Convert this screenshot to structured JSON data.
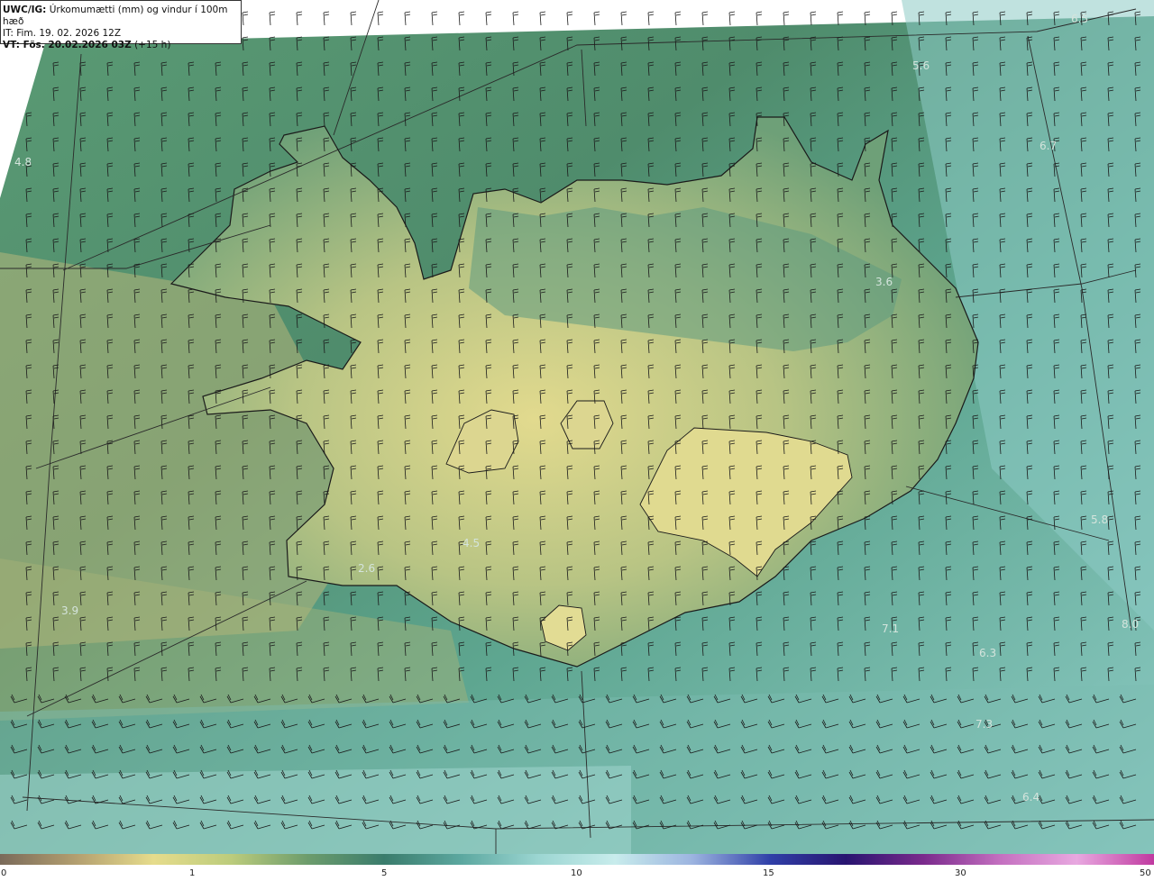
{
  "header": {
    "model": "UWC/IG:",
    "product": "Úrkomumætti (mm) og vindur í 100m hæð",
    "init_time": "IT: Fim. 19. 02. 2026 12Z",
    "valid_label": "VT: Fös. 20.02.2026 03Z",
    "lead": "(+15 h)"
  },
  "value_labels": [
    "6.5",
    "5.6",
    "6.7",
    "4.8",
    "3.6",
    "5.8",
    "4.5",
    "2.6",
    "3.9",
    "7.1",
    "8.0",
    "6.3",
    "7.3",
    "6.4"
  ],
  "colorbar": {
    "ticks": [
      "0",
      "1",
      "5",
      "10",
      "15",
      "30",
      "50"
    ],
    "colors": [
      "#7a6a5a",
      "#b4a070",
      "#e6dc8c",
      "#bccc7c",
      "#6c9c6c",
      "#3a7c6c",
      "#5ca8a0",
      "#9cd6d2",
      "#c8ecec",
      "#9cb4e0",
      "#3040a8",
      "#281470",
      "#7a2a8c",
      "#c470c0",
      "#e8a8e0",
      "#c03aa0"
    ]
  },
  "colors": {
    "land_low": "#dcd68c",
    "land_mid": "#9cb87c",
    "sea_dark": "#3e7c64",
    "sea_light": "#8ccac4",
    "graticule": "#2a2a2a",
    "coast": "#1a1a1a"
  }
}
